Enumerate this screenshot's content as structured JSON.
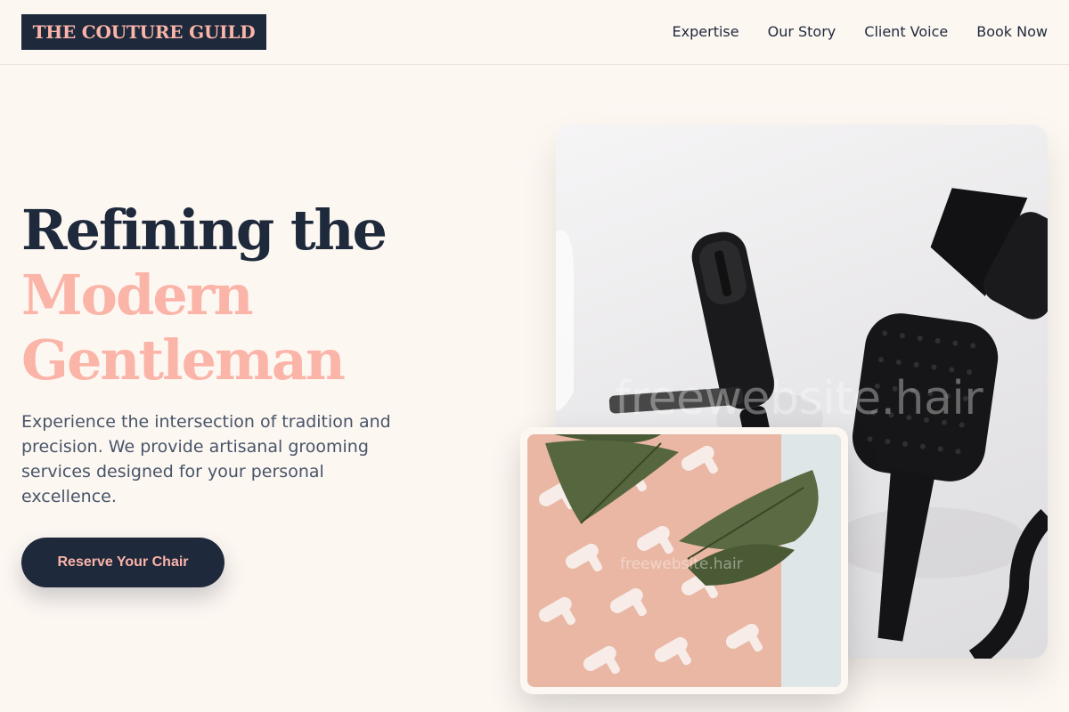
{
  "header": {
    "logo": "THE COUTURE GUILD",
    "nav": [
      "Expertise",
      "Our Story",
      "Client Voice",
      "Book Now"
    ]
  },
  "hero": {
    "title_line1": "Refining the",
    "title_line2": "Modern",
    "title_line3": "Gentleman",
    "description": "Experience the intersection of tradition and precision. We provide artisanal grooming services designed for your personal excellence.",
    "cta_label": "Reserve Your Chair"
  },
  "images": {
    "main_watermark": "freewebsite.hair",
    "secondary_watermark": "freewebsite.hair"
  },
  "colors": {
    "navy": "#1e293b",
    "blush": "#fbb4a8",
    "background": "#fdf7f2",
    "body_text": "#475569"
  }
}
